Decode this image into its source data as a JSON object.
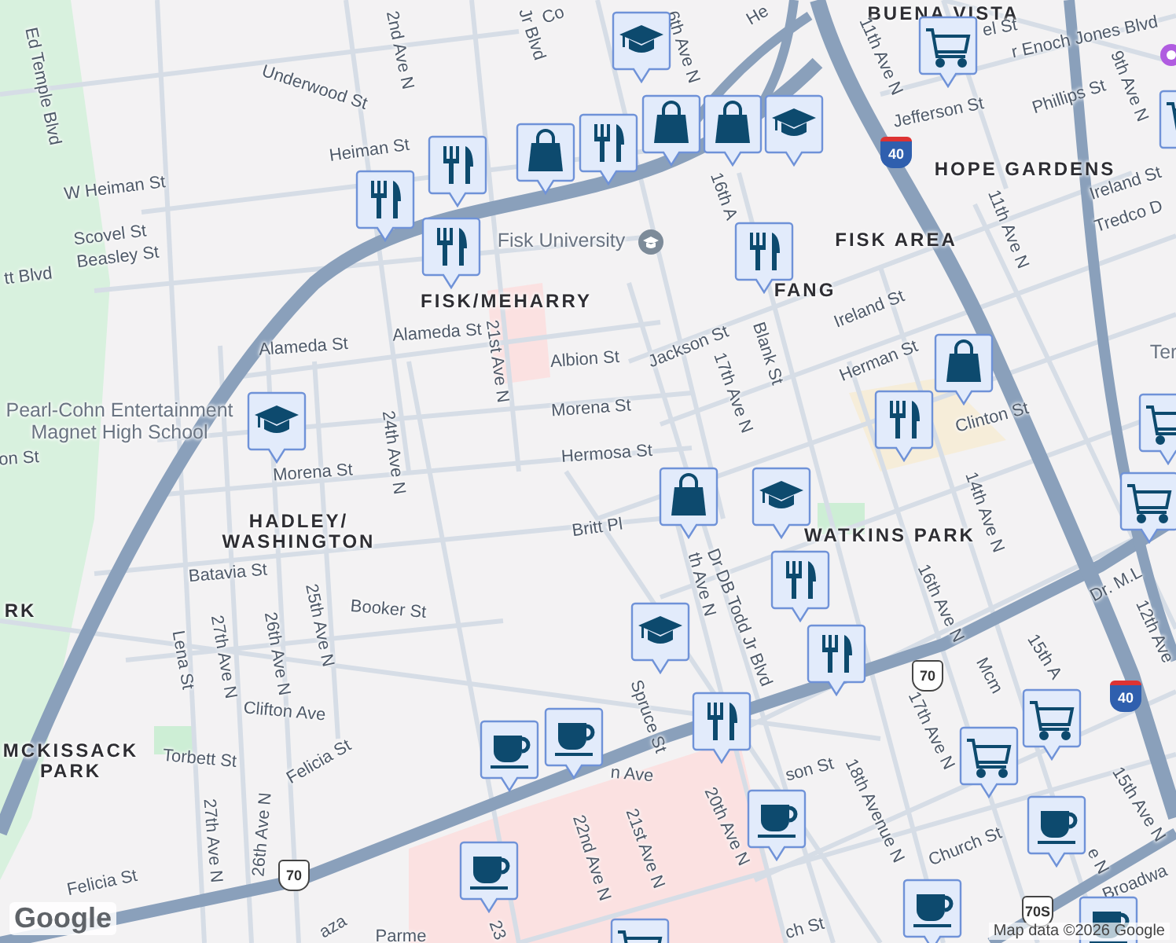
{
  "labels": [
    {
      "text": "Ed Temple Blvd",
      "kind": "street"
    },
    {
      "text": "Underwood St",
      "kind": "street"
    },
    {
      "text": "2nd Ave N",
      "kind": "street"
    },
    {
      "text": "Jr Blvd",
      "kind": "street"
    },
    {
      "text": "Co",
      "kind": "street"
    },
    {
      "text": "He",
      "kind": "street"
    },
    {
      "text": "6th Ave N",
      "kind": "street"
    },
    {
      "text": "Heiman St",
      "kind": "street"
    },
    {
      "text": "W Heiman St",
      "kind": "street"
    },
    {
      "text": "Scovel St",
      "kind": "street"
    },
    {
      "text": "Beasley St",
      "kind": "street"
    },
    {
      "text": "tt Blvd",
      "kind": "street"
    },
    {
      "text": "Fisk University",
      "kind": "poi"
    },
    {
      "text": "FISK/MEHARRY",
      "kind": "area"
    },
    {
      "text": "Alameda St",
      "kind": "street"
    },
    {
      "text": "Alameda St",
      "kind": "street"
    },
    {
      "text": "21st Ave N",
      "kind": "street"
    },
    {
      "text": "Albion St",
      "kind": "street"
    },
    {
      "text": "Morena St",
      "kind": "street"
    },
    {
      "text": "Morena St",
      "kind": "street"
    },
    {
      "text": "Hermosa St",
      "kind": "street"
    },
    {
      "text": "on St",
      "kind": "street"
    },
    {
      "text": "24th Ave N",
      "kind": "street"
    },
    {
      "text": "Pearl-Cohn Entertainment",
      "kind": "poi"
    },
    {
      "text": "Magnet High School",
      "kind": "poi"
    },
    {
      "text": "BUENA VISTA",
      "kind": "area"
    },
    {
      "text": "el St",
      "kind": "street"
    },
    {
      "text": "r Enoch Jones Blvd",
      "kind": "street"
    },
    {
      "text": "11th Ave N",
      "kind": "street"
    },
    {
      "text": "Jefferson St",
      "kind": "street"
    },
    {
      "text": "Phillips St",
      "kind": "street"
    },
    {
      "text": "9th Ave N",
      "kind": "street"
    },
    {
      "text": "HOPE GARDENS",
      "kind": "area"
    },
    {
      "text": "Ireland St",
      "kind": "street"
    },
    {
      "text": "Tredco D",
      "kind": "street"
    },
    {
      "text": "11th Ave N",
      "kind": "street"
    },
    {
      "text": "16th A",
      "kind": "street"
    },
    {
      "text": "FISK AREA",
      "kind": "area"
    },
    {
      "text": "FANG",
      "kind": "area"
    },
    {
      "text": "Ireland St",
      "kind": "street"
    },
    {
      "text": "Jackson St",
      "kind": "street"
    },
    {
      "text": "17th Ave N",
      "kind": "street"
    },
    {
      "text": "Blank St",
      "kind": "street"
    },
    {
      "text": "Herman St",
      "kind": "street"
    },
    {
      "text": "Clinton St",
      "kind": "street"
    },
    {
      "text": "Ter",
      "kind": "poi"
    },
    {
      "text": "HADLEY/",
      "kind": "area"
    },
    {
      "text": "WASHINGTON",
      "kind": "area"
    },
    {
      "text": "Batavia St",
      "kind": "street"
    },
    {
      "text": "Booker St",
      "kind": "street"
    },
    {
      "text": "Lena St",
      "kind": "street"
    },
    {
      "text": "27th Ave N",
      "kind": "street"
    },
    {
      "text": "26th Ave N",
      "kind": "street"
    },
    {
      "text": "25th Ave N",
      "kind": "street"
    },
    {
      "text": "Clifton Ave",
      "kind": "street"
    },
    {
      "text": "MCKISSACK",
      "kind": "area"
    },
    {
      "text": "PARK",
      "kind": "area"
    },
    {
      "text": "RK",
      "kind": "area"
    },
    {
      "text": "Torbett St",
      "kind": "street"
    },
    {
      "text": "Felicia St",
      "kind": "street"
    },
    {
      "text": "27th Ave N",
      "kind": "street"
    },
    {
      "text": "26th Ave N",
      "kind": "street"
    },
    {
      "text": "Felicia St",
      "kind": "street"
    },
    {
      "text": "n Ave",
      "kind": "street"
    },
    {
      "text": "Britt Pl",
      "kind": "street"
    },
    {
      "text": "WATKINS PARK",
      "kind": "area"
    },
    {
      "text": "Dr DB Todd Jr Blvd",
      "kind": "street"
    },
    {
      "text": "th Ave N",
      "kind": "street"
    },
    {
      "text": "Spruce St",
      "kind": "street"
    },
    {
      "text": "21st Ave N",
      "kind": "street"
    },
    {
      "text": "20th Ave N",
      "kind": "street"
    },
    {
      "text": "22nd Ave N",
      "kind": "street"
    },
    {
      "text": "23",
      "kind": "street"
    },
    {
      "text": "son St",
      "kind": "street"
    },
    {
      "text": "18th Avenue N",
      "kind": "street"
    },
    {
      "text": "17th Ave N",
      "kind": "street"
    },
    {
      "text": "16th Ave N",
      "kind": "street"
    },
    {
      "text": "14th Ave N",
      "kind": "street"
    },
    {
      "text": "Mcm",
      "kind": "street"
    },
    {
      "text": "15th A",
      "kind": "street"
    },
    {
      "text": "15th Ave N",
      "kind": "street"
    },
    {
      "text": "e N",
      "kind": "street"
    },
    {
      "text": "Church St",
      "kind": "street"
    },
    {
      "text": "Broadwa",
      "kind": "street"
    },
    {
      "text": "ch St",
      "kind": "street"
    },
    {
      "text": "Dr. M.L",
      "kind": "street"
    },
    {
      "text": "12th Ave",
      "kind": "street"
    },
    {
      "text": "Parme",
      "kind": "street"
    },
    {
      "text": "aza",
      "kind": "street"
    }
  ],
  "shields": [
    {
      "text": "40",
      "kind": "interstate"
    },
    {
      "text": "40",
      "kind": "interstate"
    },
    {
      "text": "70",
      "kind": "us"
    },
    {
      "text": "70",
      "kind": "us"
    },
    {
      "text": "70S",
      "kind": "us"
    }
  ],
  "pins": [
    {
      "kind": "school"
    },
    {
      "kind": "shopping"
    },
    {
      "kind": "restaurant"
    },
    {
      "kind": "shopping"
    },
    {
      "kind": "shopping"
    },
    {
      "kind": "school"
    },
    {
      "kind": "restaurant"
    },
    {
      "kind": "restaurant"
    },
    {
      "kind": "restaurant"
    },
    {
      "kind": "restaurant"
    },
    {
      "kind": "grocery"
    },
    {
      "kind": "grocery"
    },
    {
      "kind": "school"
    },
    {
      "kind": "shopping"
    },
    {
      "kind": "restaurant"
    },
    {
      "kind": "grocery"
    },
    {
      "kind": "grocery"
    },
    {
      "kind": "shopping"
    },
    {
      "kind": "school"
    },
    {
      "kind": "restaurant"
    },
    {
      "kind": "restaurant"
    },
    {
      "kind": "restaurant"
    },
    {
      "kind": "school"
    },
    {
      "kind": "grocery"
    },
    {
      "kind": "grocery"
    },
    {
      "kind": "cafe"
    },
    {
      "kind": "cafe"
    },
    {
      "kind": "cafe"
    },
    {
      "kind": "cafe"
    },
    {
      "kind": "cafe"
    },
    {
      "kind": "cafe"
    },
    {
      "kind": "cafe"
    },
    {
      "kind": "grocery"
    }
  ],
  "logo": "Google",
  "attribution": "Map data ©2026 Google"
}
